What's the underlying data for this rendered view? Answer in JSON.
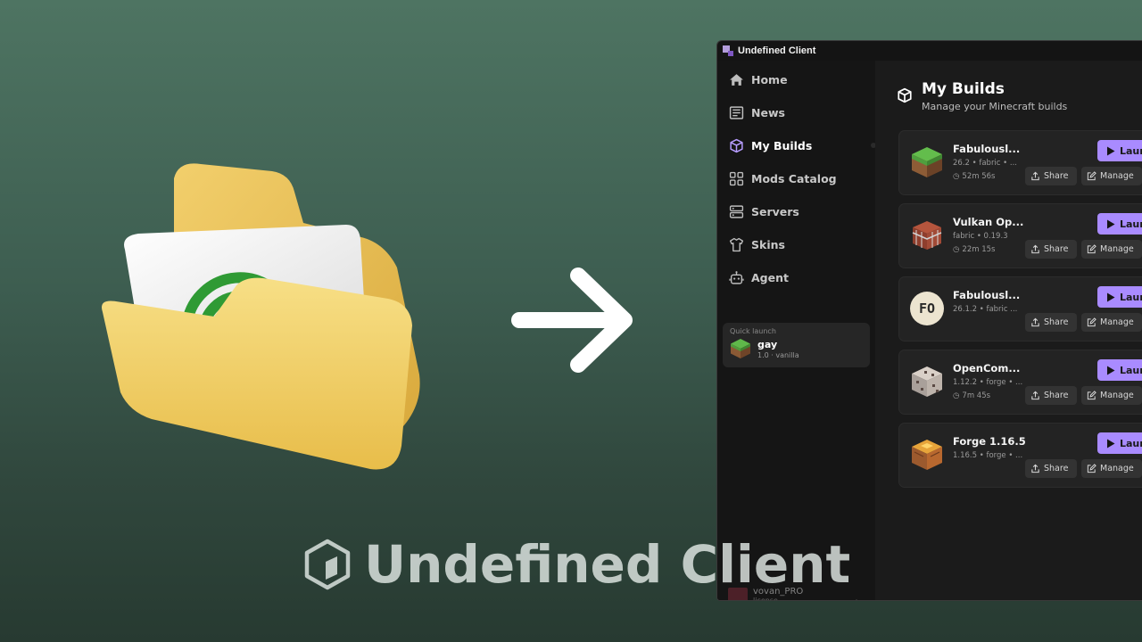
{
  "window": {
    "title": "Undefined Client"
  },
  "sidebar": {
    "items": [
      {
        "label": "Home",
        "icon": "home-icon"
      },
      {
        "label": "News",
        "icon": "news-icon"
      },
      {
        "label": "My Builds",
        "icon": "cube-icon",
        "active": true
      },
      {
        "label": "Mods Catalog",
        "icon": "grid-icon"
      },
      {
        "label": "Servers",
        "icon": "server-icon"
      },
      {
        "label": "Skins",
        "icon": "shirt-icon"
      },
      {
        "label": "Agent",
        "icon": "robot-icon"
      }
    ],
    "quick_launch": {
      "label": "Quick launch",
      "name": "gay",
      "meta": "1.0 · vanilla"
    },
    "user": {
      "name": "vovan_PRO",
      "sub": "license"
    }
  },
  "main": {
    "title": "My Builds",
    "subtitle": "Manage your Minecraft builds",
    "builds": [
      {
        "name": "Fabulousl...",
        "meta": "26.2 • fabric • ...",
        "time": "52m 56s",
        "icon": "grass-block-icon"
      },
      {
        "name": "Vulkan Op...",
        "meta": "fabric • 0.19.3",
        "time": "22m 15s",
        "icon": "chest-icon"
      },
      {
        "name": "Fabulousl...",
        "meta": "26.1.2 • fabric ...",
        "time": "",
        "icon": "fo-initials-icon",
        "initials": "FO"
      },
      {
        "name": "OpenCom...",
        "meta": "1.12.2 • forge • ...",
        "time": "7m 45s",
        "icon": "ore-block-icon"
      },
      {
        "name": "Forge 1.16.5",
        "meta": "1.16.5 • forge • ...",
        "time": "",
        "icon": "lamp-block-icon"
      }
    ],
    "buttons": {
      "launch": "Laun",
      "share": "Share",
      "manage": "Manage"
    }
  },
  "branding": {
    "text": "Undefined Client"
  },
  "colors": {
    "accent": "#a98bff",
    "background": "#4e7462",
    "window": "#141414"
  }
}
